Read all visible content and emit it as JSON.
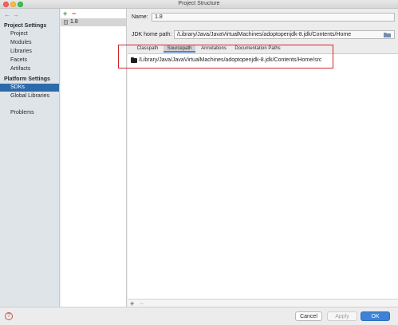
{
  "window": {
    "title": "Project Structure"
  },
  "nav": {
    "project_settings_header": "Project Settings",
    "project_settings_items": [
      "Project",
      "Modules",
      "Libraries",
      "Facets",
      "Artifacts"
    ],
    "platform_settings_header": "Platform Settings",
    "platform_settings_items": [
      "SDKs",
      "Global Libraries"
    ],
    "selected_item": "SDKs",
    "problems": "Problems"
  },
  "sdk_list": {
    "add_icon": "plus-icon",
    "remove_icon": "minus-icon",
    "items": [
      "1.8"
    ]
  },
  "sdk_details": {
    "name_label": "Name:",
    "name_value": "1.8",
    "home_path_label": "JDK home path:",
    "home_path_value": "/Library/Java/JavaVirtualMachines/adoptopenjdk-8.jdk/Contents/Home",
    "tabs": [
      "Classpath",
      "Sourcepath",
      "Annotations",
      "Documentation Paths"
    ],
    "active_tab": "Sourcepath",
    "paths": [
      "/Library/Java/JavaVirtualMachines/adoptopenjdk-8.jdk/Contents/Home/src"
    ]
  },
  "footer": {
    "help_label": "?",
    "cancel": "Cancel",
    "apply": "Apply",
    "ok": "OK"
  },
  "colors": {
    "selection": "#2d6aab",
    "highlight_box": "#d4252b",
    "ok_button": "#3c82d6"
  }
}
